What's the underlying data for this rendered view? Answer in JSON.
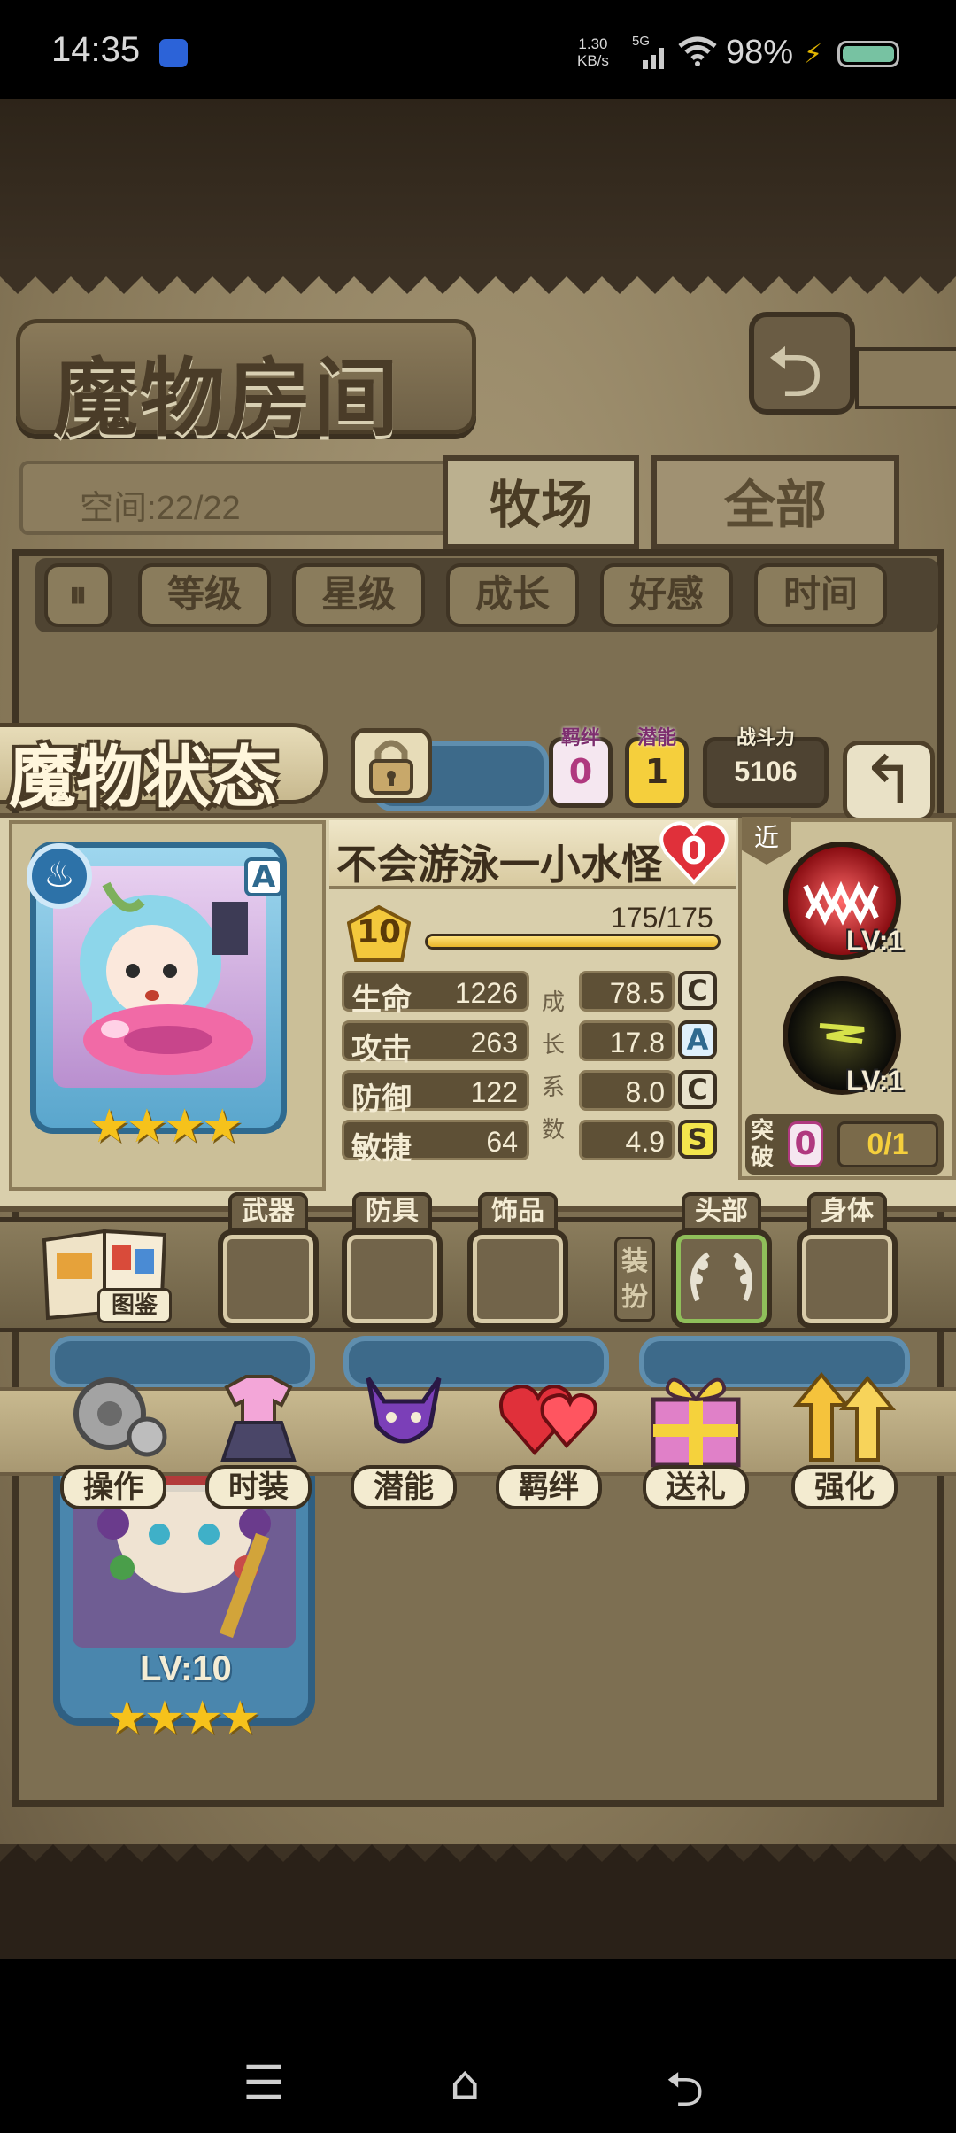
{
  "status_bar": {
    "time": "14:35",
    "net_speed_value": "1.30",
    "net_speed_unit": "KB/s",
    "network": "5G",
    "battery": "98%",
    "icons": [
      "app-notification-icon",
      "signal-icon",
      "wifi-icon",
      "charging-icon",
      "battery-icon"
    ]
  },
  "room": {
    "title": "魔物房间",
    "space": "空间:22/22",
    "tabs": [
      {
        "label": "牧场",
        "active": true
      },
      {
        "label": "全部",
        "active": false
      }
    ],
    "sort_buttons": [
      "等级",
      "星级",
      "成长",
      "好感",
      "时间"
    ],
    "bottom_card_level": "LV:10"
  },
  "popup": {
    "title": "魔物状态",
    "bond_label": "羁绊",
    "bond_value": "0",
    "potential_label": "潜能",
    "potential_value": "1",
    "power_label": "战斗力",
    "power_value": "5106",
    "monster_name": "不会游泳一小水怪",
    "affection": "0",
    "rank": "A",
    "stars": 4,
    "level": "10",
    "exp_text": "175/175",
    "exp_fraction": 1.0,
    "stats": [
      {
        "label": "生命",
        "value": "1226",
        "growth": "78.5",
        "grade": "C"
      },
      {
        "label": "攻击",
        "value": "263",
        "growth": "17.8",
        "grade": "A"
      },
      {
        "label": "防御",
        "value": "122",
        "growth": "8.0",
        "grade": "C"
      },
      {
        "label": "敏捷",
        "value": "64",
        "growth": "4.9",
        "grade": "S"
      }
    ],
    "growth_vertical": [
      "成",
      "长",
      "系",
      "数"
    ],
    "range_tag": "近",
    "skills": [
      {
        "level": "LV:1"
      },
      {
        "level": "LV:1"
      }
    ],
    "breakthrough_label": "突破",
    "breakthrough_value": "0",
    "breakthrough_progress": "0/1",
    "book_label": "图鉴",
    "equip_slots": [
      "武器",
      "防具",
      "饰品"
    ],
    "dress_label": "装扮",
    "dress_slots": [
      "头部",
      "身体"
    ],
    "actions": [
      "操作",
      "时装",
      "潜能",
      "羁绊",
      "送礼",
      "强化"
    ]
  },
  "colors": {
    "grade_C": "#e8e2cc",
    "grade_A": "#dff0fb",
    "grade_S": "#f3e64d",
    "accent_pink": "#b0397f",
    "gold": "#f5cf3c"
  }
}
